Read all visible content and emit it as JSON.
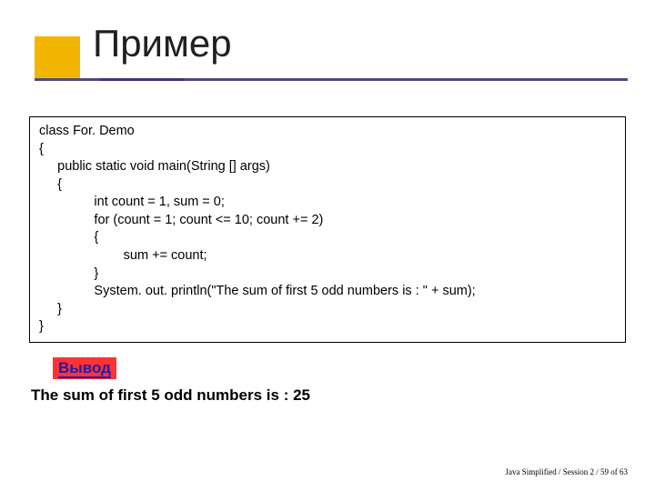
{
  "title": "Пример",
  "code": "class For. Demo\n{\n     public static void main(String [] args)\n     {\n               int count = 1, sum = 0;\n               for (count = 1; count <= 10; count += 2)\n               {\n                       sum += count;\n               }\n               System. out. println(\"The sum of first 5 odd numbers is : \" + sum);\n     }\n}",
  "output_label": "Вывод",
  "output_text": "The sum of first 5 odd numbers is : 25",
  "footer": "Java Simplified / Session 2 / 59 of 63"
}
